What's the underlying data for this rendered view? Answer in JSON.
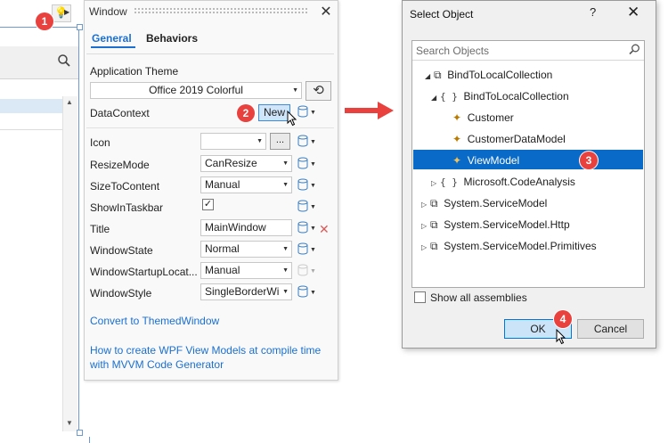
{
  "callouts": [
    "1",
    "2",
    "3",
    "4"
  ],
  "window_panel": {
    "title": "Window",
    "tabs": [
      "General",
      "Behaviors"
    ],
    "application_theme_label": "Application Theme",
    "application_theme_value": "Office 2019 Colorful",
    "datacontext_label": "DataContext",
    "new_button": "New",
    "properties": [
      {
        "name": "Icon",
        "value": "",
        "type": "icon-combo"
      },
      {
        "name": "ResizeMode",
        "value": "CanResize",
        "type": "combo"
      },
      {
        "name": "SizeToContent",
        "value": "Manual",
        "type": "combo"
      },
      {
        "name": "ShowInTaskbar",
        "checked": true,
        "type": "check"
      },
      {
        "name": "Title",
        "value": "MainWindow",
        "type": "text"
      },
      {
        "name": "WindowState",
        "value": "Normal",
        "type": "combo"
      },
      {
        "name": "WindowStartupLocat...",
        "value": "Manual",
        "type": "combo"
      },
      {
        "name": "WindowStyle",
        "value": "SingleBorderWi",
        "type": "combo"
      }
    ],
    "ellipsis_button": "...",
    "convert_link": "Convert to ThemedWindow",
    "help_link_line1": "How to create WPF View Models at compile time",
    "help_link_line2": "with MVVM Code Generator"
  },
  "select_dialog": {
    "title": "Select Object",
    "help": "?",
    "close": "✕",
    "search_placeholder": "Search Objects",
    "tree": [
      {
        "label": "BindToLocalCollection",
        "kind": "assembly",
        "expanded": true
      },
      {
        "label": "BindToLocalCollection",
        "kind": "namespace",
        "expanded": true
      },
      {
        "label": "Customer",
        "kind": "class"
      },
      {
        "label": "CustomerDataModel",
        "kind": "class"
      },
      {
        "label": "ViewModel",
        "kind": "class",
        "selected": true
      },
      {
        "label": "Microsoft.CodeAnalysis",
        "kind": "namespace",
        "expanded": false
      },
      {
        "label": "System.ServiceModel",
        "kind": "assembly",
        "expanded": false
      },
      {
        "label": "System.ServiceModel.Http",
        "kind": "assembly",
        "expanded": false
      },
      {
        "label": "System.ServiceModel.Primitives",
        "kind": "assembly",
        "expanded": false
      }
    ],
    "show_all_label": "Show all assemblies",
    "ok": "OK",
    "cancel": "Cancel"
  },
  "colors": {
    "accent": "#1a6fd1",
    "selection": "#0a6ac7",
    "callout": "#e8413e"
  }
}
